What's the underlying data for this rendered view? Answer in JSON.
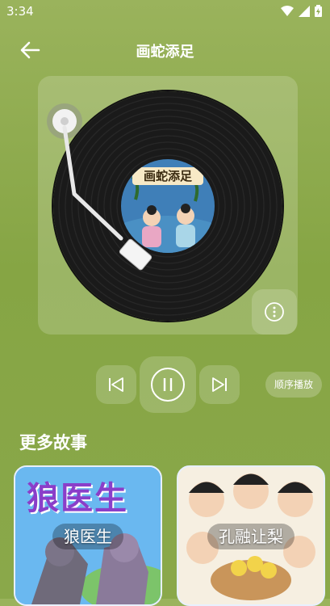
{
  "status": {
    "time": "3:34"
  },
  "header": {
    "title": "画蛇添足"
  },
  "player": {
    "album_label": "画蛇添足",
    "mode_label": "顺序播放"
  },
  "more_stories": {
    "title": "更多故事",
    "items": [
      {
        "cover_title": "狼医生",
        "label": "狼医生"
      },
      {
        "cover_title": "",
        "label": "孔融让梨"
      }
    ]
  },
  "colors": {
    "background": "#8aa84a",
    "record": "#1a1a1a"
  },
  "icons": [
    "back-arrow-icon",
    "more-icon",
    "previous-icon",
    "pause-icon",
    "next-icon",
    "wifi-icon",
    "signal-icon",
    "battery-icon"
  ]
}
